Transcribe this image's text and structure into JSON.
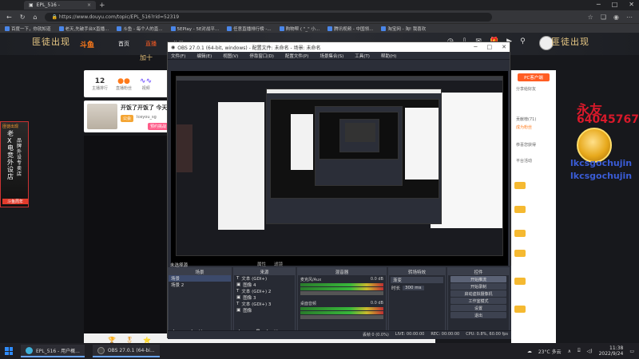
{
  "browser": {
    "tab_title": "EPL_516 - ",
    "url": "https://www.douyu.com/topic/EPL_516?rid=52319",
    "bookmarks": [
      "百度一下，你就知道",
      "老天,先破手台X直播...",
      "斗鱼 - 每个人的直...",
      "5EPlay - 5E对战平...",
      "任意直播排行榜 -...",
      "购物帮 ( \"_\" 小...",
      "腾讯视频 - 中国领...",
      "淘宝网 - 淘! 我喜欢"
    ]
  },
  "site": {
    "nav": [
      "首页",
      "直播",
      "分类"
    ],
    "banner_left": "匪徒出现",
    "banner_right": "匪徒出现",
    "subtitle": "加十",
    "stats": [
      {
        "value": "12",
        "label": "主播排行"
      },
      {
        "value": "",
        "label": "直播粉丝"
      },
      {
        "value": "",
        "label": "视频"
      }
    ],
    "anchor": {
      "title": "开饭了开饭了 今天",
      "tag": "公会",
      "name": "Iceyou_sg",
      "button": "预约挑战"
    },
    "left_ad": {
      "title": "匪徒出现",
      "text1": "老X电竞外设店",
      "text2": "品牌外设专卖店",
      "badge": "斗鱼周年"
    },
    "right_panel": {
      "button": "PC客户端",
      "lines": [
        "分享给好友",
        "成为粉丝",
        "贡献榜(71)",
        "恭喜您获得",
        "平台活动"
      ]
    },
    "overlay": {
      "red_name": "永友",
      "red_number": "6404",
      "red_number2": "64045767",
      "blue_name": "lkcsgochujin",
      "blue_name2": "lkcsgochujin",
      "small_red": "永友",
      "small_blue": "lkcsgochujin"
    }
  },
  "obs": {
    "title": "OBS 27.0.1 (64-bit, windows) - 配置文件: 未命名 - 场景: 未命名",
    "menu": [
      "文件(F)",
      "编辑(E)",
      "视图(V)",
      "停靠窗口(D)",
      "配置文件(P)",
      "场景集合(S)",
      "工具(T)",
      "帮助(H)"
    ],
    "docks": {
      "scenes_title": "场景",
      "scenes": [
        "场景",
        "场景 2"
      ],
      "sources_title": "来源",
      "sources": [
        "文本 (GDI+)",
        "图像 4",
        "文本 (GDI+) 2",
        "图像 3",
        "文本 (GDI+) 3",
        "图像"
      ],
      "mixer_title": "混音器",
      "mixer": [
        {
          "name": "麦克风/Aux",
          "db": "0.0 dB"
        },
        {
          "name": "桌面音频",
          "db": "0.0 dB"
        }
      ],
      "transitions_title": "转场特效",
      "transition": "渐变",
      "duration_label": "时长",
      "duration": "300 ms",
      "controls_title": "控件",
      "controls": [
        "开始推流",
        "开始录制",
        "启动虚拟摄像机",
        "工作室模式",
        "设置",
        "退出"
      ],
      "scene_bar_left": "未选择源",
      "props": "属性",
      "filters": "滤镜"
    },
    "status": {
      "dropped": "丢帧 0 (0.0%)",
      "live": "LIVE: 00:00:00",
      "rec": "REC: 00:00:00",
      "cpu": "CPU: 0.8%, 60.00 fps"
    }
  },
  "taskbar": {
    "items": [
      "EPL_516 - 用户概...",
      "OBS 27.0.1 (64-bi..."
    ],
    "weather": "23°C 多云",
    "time": "11:38",
    "date": "2022/9/24"
  }
}
